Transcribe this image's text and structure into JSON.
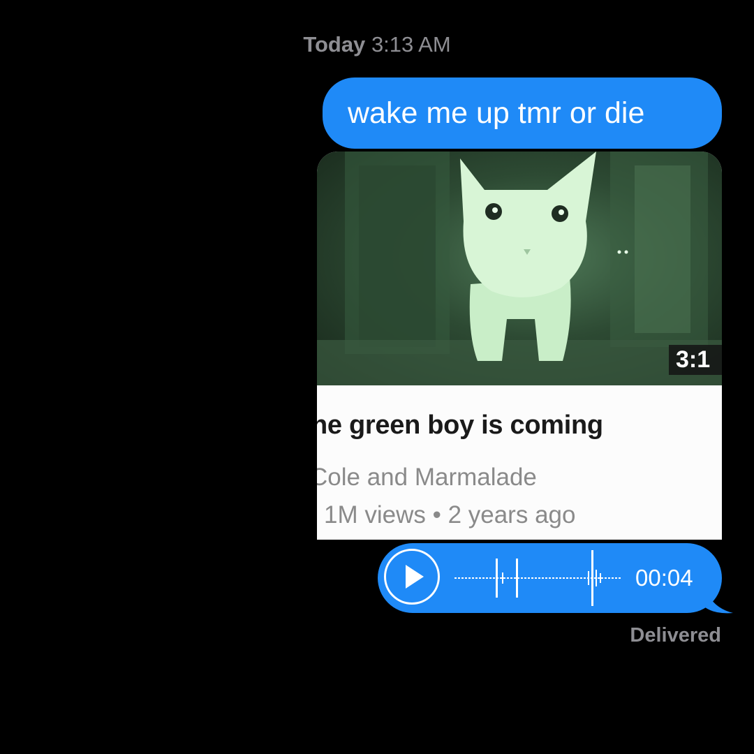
{
  "timestamp": {
    "day": "Today",
    "time": "3:13 AM"
  },
  "messages": [
    {
      "type": "text",
      "text": "wake me up tmr or die"
    }
  ],
  "video_preview": {
    "duration": "3:1",
    "title": "he green boy is coming",
    "channel": "Cole and Marmalade",
    "meta": "1M views • 2 years ago"
  },
  "audio_message": {
    "duration": "00:04",
    "play_icon": "play-icon"
  },
  "status": "Delivered",
  "colors": {
    "background": "#000000",
    "bubble_blue": "#1f8af7",
    "timestamp_gray": "#8e8e93"
  }
}
